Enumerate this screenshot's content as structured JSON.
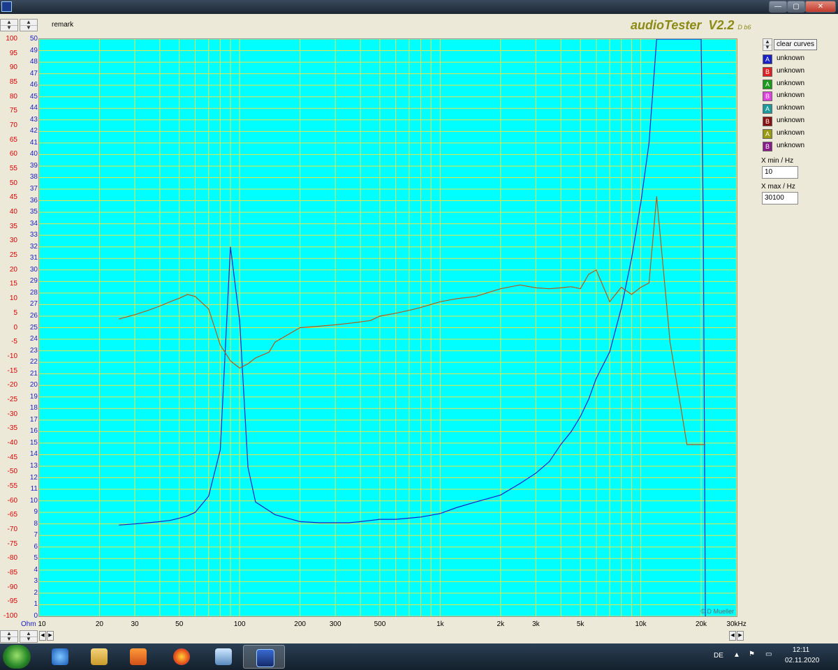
{
  "window": {
    "minimize_label": "—",
    "maximize_label": "▢",
    "close_label": "✕"
  },
  "header": {
    "remark_label": "remark",
    "brand_name": "audioTester",
    "brand_version": "V2.2",
    "brand_suffix": "D b6"
  },
  "chart_data": {
    "type": "line",
    "x_scale": "log",
    "xlim": [
      10,
      30100
    ],
    "x_tick_labels": [
      "10",
      "20",
      "30",
      "50",
      "100",
      "200",
      "300",
      "500",
      "1k",
      "2k",
      "3k",
      "5k",
      "10k",
      "20k",
      "30kHz"
    ],
    "x_tick_values": [
      10,
      20,
      30,
      50,
      100,
      200,
      300,
      500,
      1000,
      2000,
      3000,
      5000,
      10000,
      20000,
      30000
    ],
    "left_axis_labels": [
      "100",
      "95",
      "90",
      "85",
      "80",
      "75",
      "70",
      "65",
      "60",
      "55",
      "50",
      "45",
      "40",
      "35",
      "30",
      "25",
      "20",
      "15",
      "10",
      "5",
      "0",
      "-5",
      "-10",
      "-15",
      "-20",
      "-25",
      "-30",
      "-35",
      "-40",
      "-45",
      "-50",
      "-55",
      "-60",
      "-65",
      "-70",
      "-75",
      "-80",
      "-85",
      "-90",
      "-95",
      "-100"
    ],
    "right_axis_labels": [
      "50",
      "49",
      "48",
      "47",
      "46",
      "45",
      "44",
      "43",
      "42",
      "41",
      "40",
      "39",
      "38",
      "37",
      "36",
      "35",
      "34",
      "33",
      "32",
      "31",
      "30",
      "29",
      "28",
      "27",
      "26",
      "25",
      "24",
      "23",
      "22",
      "21",
      "20",
      "19",
      "18",
      "17",
      "16",
      "15",
      "14",
      "13",
      "12",
      "11",
      "10",
      "9",
      "8",
      "7",
      "6",
      "5",
      "4",
      "3",
      "2",
      "1",
      "0"
    ],
    "ylabel_impedance": "Ohm",
    "ylim_impedance": [
      0,
      50
    ],
    "ylim_phase": [
      -100,
      100
    ],
    "watermark": "© D Mueller",
    "series": [
      {
        "kind": "impedance",
        "color": "#1a20c8",
        "x": [
          25,
          30,
          35,
          40,
          45,
          50,
          55,
          60,
          70,
          80,
          90,
          100,
          110,
          120,
          150,
          200,
          250,
          300,
          350,
          400,
          450,
          500,
          600,
          700,
          800,
          1000,
          1200,
          1500,
          2000,
          2500,
          3000,
          3500,
          4000,
          4500,
          5000,
          5500,
          6000,
          7000,
          8000,
          9000,
          10000,
          11000,
          12000,
          20000,
          20500,
          21000
        ],
        "y": [
          7.9,
          8.0,
          8.1,
          8.2,
          8.3,
          8.5,
          8.7,
          9.0,
          10.4,
          14.4,
          32.0,
          25.6,
          12.9,
          9.9,
          8.8,
          8.2,
          8.1,
          8.1,
          8.1,
          8.2,
          8.3,
          8.4,
          8.4,
          8.5,
          8.6,
          8.9,
          9.4,
          9.9,
          10.5,
          11.5,
          12.4,
          13.4,
          14.9,
          16.0,
          17.3,
          18.8,
          20.6,
          22.9,
          26.7,
          31.0,
          35.8,
          41.0,
          50.0,
          50.0,
          34.0,
          0.0
        ]
      },
      {
        "kind": "phase",
        "color": "#b35a1a",
        "x": [
          25,
          30,
          35,
          40,
          45,
          50,
          55,
          60,
          70,
          80,
          90,
          100,
          110,
          120,
          140,
          150,
          200,
          250,
          300,
          350,
          400,
          450,
          500,
          600,
          700,
          800,
          1000,
          1200,
          1500,
          2000,
          2500,
          3000,
          3500,
          4000,
          4500,
          5000,
          5500,
          6000,
          7000,
          8000,
          9000,
          10000,
          11000,
          12000,
          14000,
          17000,
          19000,
          20000,
          20500,
          21000
        ],
        "y": [
          3.0,
          4.5,
          6.0,
          7.5,
          9.0,
          10.2,
          11.5,
          10.8,
          6.5,
          -6.0,
          -11.5,
          -14.0,
          -12.5,
          -10.5,
          -8.5,
          -5.0,
          0.0,
          0.5,
          1.0,
          1.5,
          2.0,
          2.5,
          4.0,
          5.0,
          6.0,
          7.0,
          9.0,
          10.0,
          10.8,
          13.5,
          14.8,
          13.8,
          13.5,
          13.8,
          14.2,
          13.5,
          18.5,
          20.0,
          9.0,
          14.0,
          11.5,
          14.0,
          15.5,
          45.5,
          -5.0,
          -40.5,
          -40.5,
          -40.5,
          -40.5,
          -40.5
        ]
      }
    ]
  },
  "legend": {
    "clear_label": "clear curves",
    "items": [
      {
        "letter": "A",
        "color": "#1a20c8",
        "label": "unknown"
      },
      {
        "letter": "B",
        "color": "#e02020",
        "label": "unknown"
      },
      {
        "letter": "A",
        "color": "#1a9a1a",
        "label": "unknown"
      },
      {
        "letter": "B",
        "color": "#e040e0",
        "label": "unknown"
      },
      {
        "letter": "A",
        "color": "#1a9a9a",
        "label": "unknown"
      },
      {
        "letter": "B",
        "color": "#8a1010",
        "label": "unknown"
      },
      {
        "letter": "A",
        "color": "#9a9a10",
        "label": "unknown"
      },
      {
        "letter": "B",
        "color": "#8a1a8a",
        "label": "unknown"
      }
    ]
  },
  "controls": {
    "xmin_label": "X min / Hz",
    "xmin_value": "10",
    "xmax_label": "X max / Hz",
    "xmax_value": "30100"
  },
  "taskbar": {
    "language": "DE",
    "time": "12:11",
    "date": "02.11.2020"
  }
}
